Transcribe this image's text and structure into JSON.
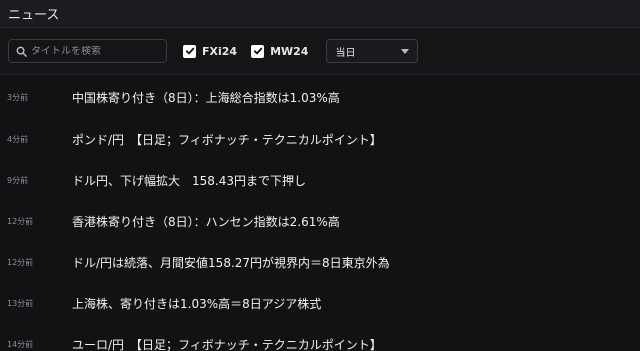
{
  "header": {
    "title": "ニュース"
  },
  "filters": {
    "search_placeholder": "タイトルを検索",
    "checkboxes": [
      {
        "label": "FXi24",
        "checked": true
      },
      {
        "label": "MW24",
        "checked": true
      }
    ],
    "period": {
      "selected": "当日"
    }
  },
  "news": [
    {
      "time": "3分前",
      "headline": "中国株寄り付き（8日）：上海総合指数は1.03%高"
    },
    {
      "time": "4分前",
      "headline": "ポンド/円　【日足；フィボナッチ・テクニカルポイント】"
    },
    {
      "time": "9分前",
      "headline": "ドル円、下げ幅拡大　158.43円まで下押し"
    },
    {
      "time": "12分前",
      "headline": "香港株寄り付き（8日）：ハンセン指数は2.61%高"
    },
    {
      "time": "12分前",
      "headline": "ドル/円は続落、月間安値158.27円が視界内＝8日東京外為"
    },
    {
      "time": "13分前",
      "headline": "上海株、寄り付きは1.03%高＝8日アジア株式"
    },
    {
      "time": "14分前",
      "headline": "ユーロ/円　【日足；フィボナッチ・テクニカルポイント】"
    }
  ],
  "colors": {
    "background": "#111214",
    "text": "#f2f2f2",
    "muted": "#8f9095",
    "checkbox": "#ffffff"
  }
}
